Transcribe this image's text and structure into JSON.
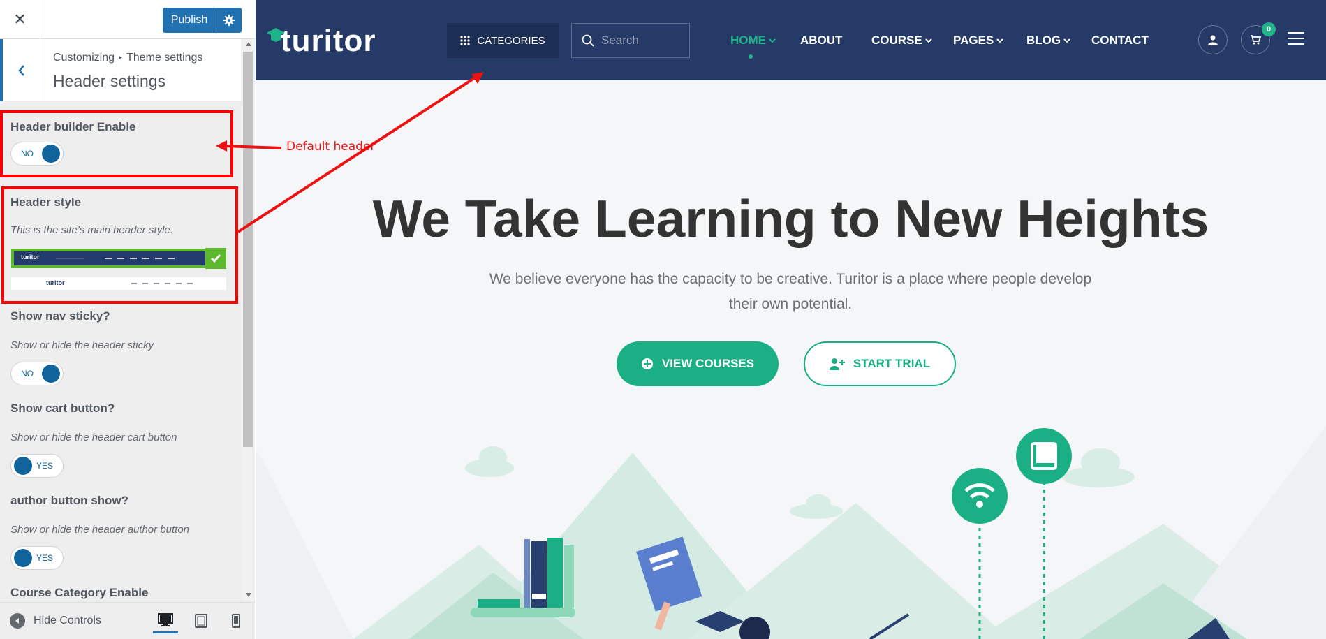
{
  "customizer": {
    "publish_label": "Publish",
    "breadcrumb": {
      "root": "Customizing",
      "parent": "Theme settings"
    },
    "section_title": "Header settings",
    "controls": {
      "header_builder": {
        "title": "Header builder Enable",
        "toggle": "NO"
      },
      "header_style": {
        "title": "Header style",
        "description": "This is the site's main header style.",
        "selected": "style-1"
      },
      "nav_sticky": {
        "title": "Show nav sticky?",
        "description": "Show or hide the header sticky",
        "toggle": "NO"
      },
      "cart_button": {
        "title": "Show cart button?",
        "description": "Show or hide the header cart button",
        "toggle": "YES"
      },
      "author_button": {
        "title": "author button show?",
        "description": "Show or hide the header author button",
        "toggle": "YES"
      },
      "course_category": {
        "title": "Course Category Enable"
      }
    },
    "footer": {
      "hide_controls": "Hide Controls"
    },
    "annotation": "Default header"
  },
  "site": {
    "logo_text": "turitor",
    "categories_label": "CATEGORIES",
    "search_placeholder": "Search",
    "nav": [
      "HOME",
      "ABOUT",
      "COURSE",
      "PAGES",
      "BLOG",
      "CONTACT"
    ],
    "cart_count": "0",
    "hero": {
      "title": "We Take Learning to New Heights",
      "subtitle": "We believe everyone has the capacity to be creative. Turitor is a place where people develop their own potential.",
      "btn_primary": "VIEW COURSES",
      "btn_secondary": "START TRIAL"
    }
  },
  "colors": {
    "header_bg": "#253a67",
    "accent_green": "#1aaf85",
    "wp_blue": "#2271b1",
    "annotation_red": "#ff0000"
  }
}
